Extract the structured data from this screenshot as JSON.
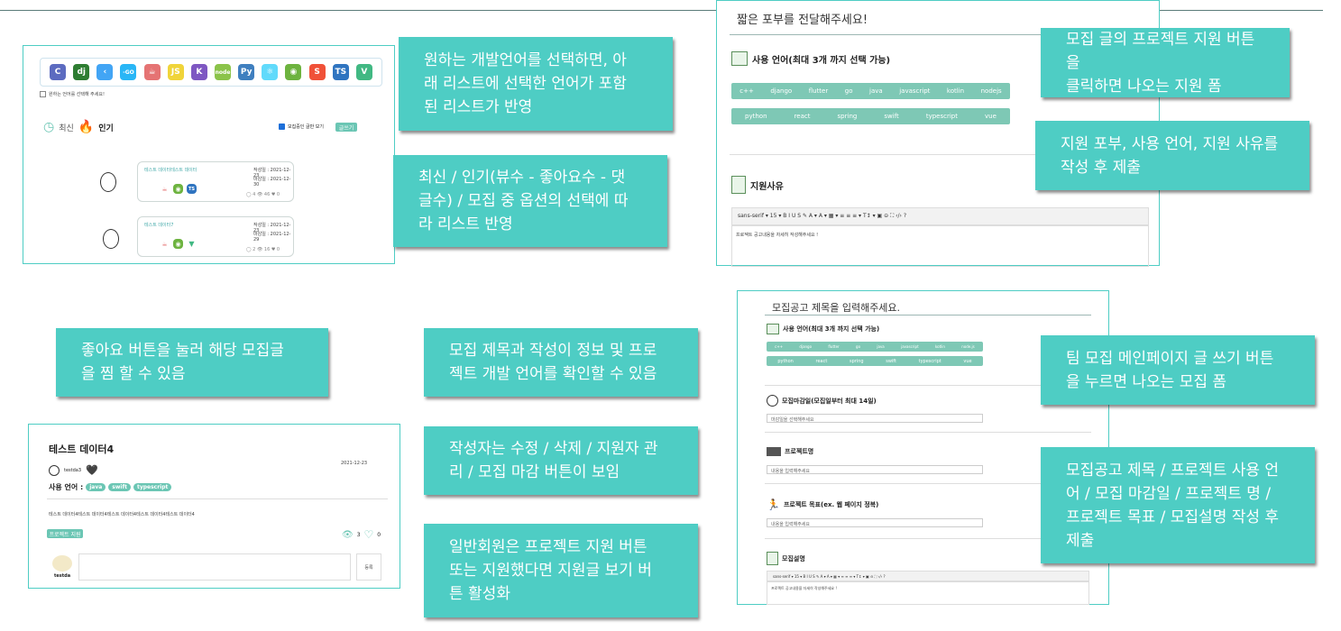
{
  "callouts": {
    "c1": [
      "원하는 개발언어를 선택하면, 아",
      "래 리스트에 선택한 언어가 포함",
      "된 리스트가 반영"
    ],
    "c2": [
      "최신 / 인기(뷰수 - 좋아요수 - 댓",
      "글수) / 모집 중 옵션의 선택에 따",
      "라 리스트 반영"
    ],
    "c3": [
      "모집 글의 프로젝트 지원 버튼을",
      "클릭하면 나오는 지원 폼"
    ],
    "c4": [
      "지원 포부, 사용 언어, 지원 사유를",
      "작성 후 제출"
    ],
    "c5": [
      "좋아요 버튼을 눌러 해당 모집글",
      "을 찜 할 수 있음"
    ],
    "c6": [
      "모집 제목과 작성이 정보 및 프로",
      "젝트 개발 언어를 확인할 수 있음"
    ],
    "c7": [
      "작성자는 수정 / 삭제 / 지원자 관",
      "리 / 모집 마감 버튼이 보임"
    ],
    "c8": [
      "일반회원은 프로젝트 지원 버튼",
      "또는 지원했다면 지원글 보기 버",
      "튼 활성화"
    ],
    "c9": [
      "팀 모집 메인페이지 글 쓰기 버튼",
      "을 누르면 나오는 모집 폼"
    ],
    "c10": [
      "모집공고 제목 / 프로젝트 사용 언",
      "어 / 모집 마감일 / 프로젝트 명 /",
      "프로젝트 목표 / 모집설명 작성 후",
      "제출"
    ]
  },
  "list_page": {
    "lang_icons": [
      {
        "name": "c-icon",
        "label": "C",
        "color": "#5c6bc0"
      },
      {
        "name": "django-icon",
        "label": "dj",
        "color": "#2e7d32"
      },
      {
        "name": "flutter-icon",
        "label": "‹",
        "color": "#42a5f5"
      },
      {
        "name": "go-icon",
        "label": "-GO",
        "color": "#29b6f6"
      },
      {
        "name": "java-icon",
        "label": "☕",
        "color": "#e57373"
      },
      {
        "name": "javascript-icon",
        "label": "JS",
        "color": "#f0d43a"
      },
      {
        "name": "kotlin-icon",
        "label": "K",
        "color": "#7e57c2"
      },
      {
        "name": "node-icon",
        "label": "node",
        "color": "#8bc34a"
      },
      {
        "name": "python-icon",
        "label": "Py",
        "color": "#3f7fbf"
      },
      {
        "name": "react-icon",
        "label": "⚛",
        "color": "#61dafb"
      },
      {
        "name": "spring-icon",
        "label": "◉",
        "color": "#6db33f"
      },
      {
        "name": "swift-icon",
        "label": "S",
        "color": "#f05138"
      },
      {
        "name": "typescript-icon",
        "label": "TS",
        "color": "#2f74c0"
      },
      {
        "name": "vue-icon",
        "label": "V",
        "color": "#41b883"
      }
    ],
    "hint": "원하는 언어를 선택해 주세요!",
    "tab_latest": "최신",
    "tab_popular": "인기",
    "recruiting_only": "모집중인 글만 보기",
    "write_button": "글쓰기",
    "posts": [
      {
        "title": "테스트 데이터테스트 데이터",
        "written": "작성일 : 2021-12-23",
        "deadline": "마감일 : 2021-12-30",
        "stats": "◯ 4  👁 46  ♥ 0"
      },
      {
        "title": "테스트 데이터7",
        "written": "작성일 : 2021-12-23",
        "deadline": "마감일 : 2021-12-29",
        "stats": "◯ 2  👁 16  ♥ 0"
      }
    ]
  },
  "apply_form": {
    "title": "짧은 포부를 전달해주세요!",
    "lang_section": "사용 언어(최대 3개 까지 선택 가능)",
    "row1": [
      "c++",
      "django",
      "flutter",
      "go",
      "java",
      "javascript",
      "kotlin",
      "nodejs"
    ],
    "row2": [
      "python",
      "react",
      "spring",
      "swift",
      "typescript",
      "vue"
    ],
    "reason_section": "지원사유",
    "toolbar": "sans-serif ▾  15 ▾   B  I  U  S  ✎   A ▾  A ▾   ▦ ▾   ≡  ≡  ≡ ▾   T↕ ▾   ▣  ⊝  ⛶  ‹/›  ?",
    "editor_placeholder": "프로젝트 공고내용을 자세히 작성해주세요 !"
  },
  "detail_page": {
    "title": "테스트 데이터4",
    "date": "2021-12-23",
    "author": "testda3",
    "langs_label": "사용 언어 :",
    "langs": [
      "java",
      "swift",
      "typescript"
    ],
    "body": "테스트 데이터4테스트 데이터4테스트 데이터4테스트 데이터4테스트 데이터4",
    "apply_button": "프로젝트 지원",
    "views": "3",
    "likes": "0",
    "commenter": "testda",
    "comment_submit": "등록"
  },
  "recruit_form": {
    "title": "모집공고 제목을 입력해주세요.",
    "lang_section": "사용 언어(최대 3개 까지 선택 가능)",
    "row1": [
      "c++",
      "django",
      "flutter",
      "go",
      "java",
      "javascript",
      "kotlin",
      "node.js"
    ],
    "row2": [
      "python",
      "react",
      "spring",
      "swift",
      "typescript",
      "vue"
    ],
    "deadline_section": "모집마감일(모집일부터 최대 14일)",
    "deadline_placeholder": "마감일을 선택해주세요",
    "project_name_section": "프로젝트명",
    "project_name_placeholder": "내용을 입력해주세요",
    "goal_section": "프로젝트 목표(ex. 웹 페이지 정복)",
    "goal_placeholder": "내용을 입력해주세요",
    "desc_section": "모집설명",
    "toolbar": "sans-serif ▾  15 ▾   B  I  U  S  ✎  A ▾  A ▾  ▦ ▾  ≡  ≡  ≡ ▾  T↕ ▾  ▣  ⊝  ⛶  ‹/›  ?",
    "editor_placeholder": "프로젝트 공고내용을 자세히 작성해주세요 !"
  },
  "colors": {
    "accent": "#4ecdc4",
    "chip": "#7ec8b5"
  }
}
